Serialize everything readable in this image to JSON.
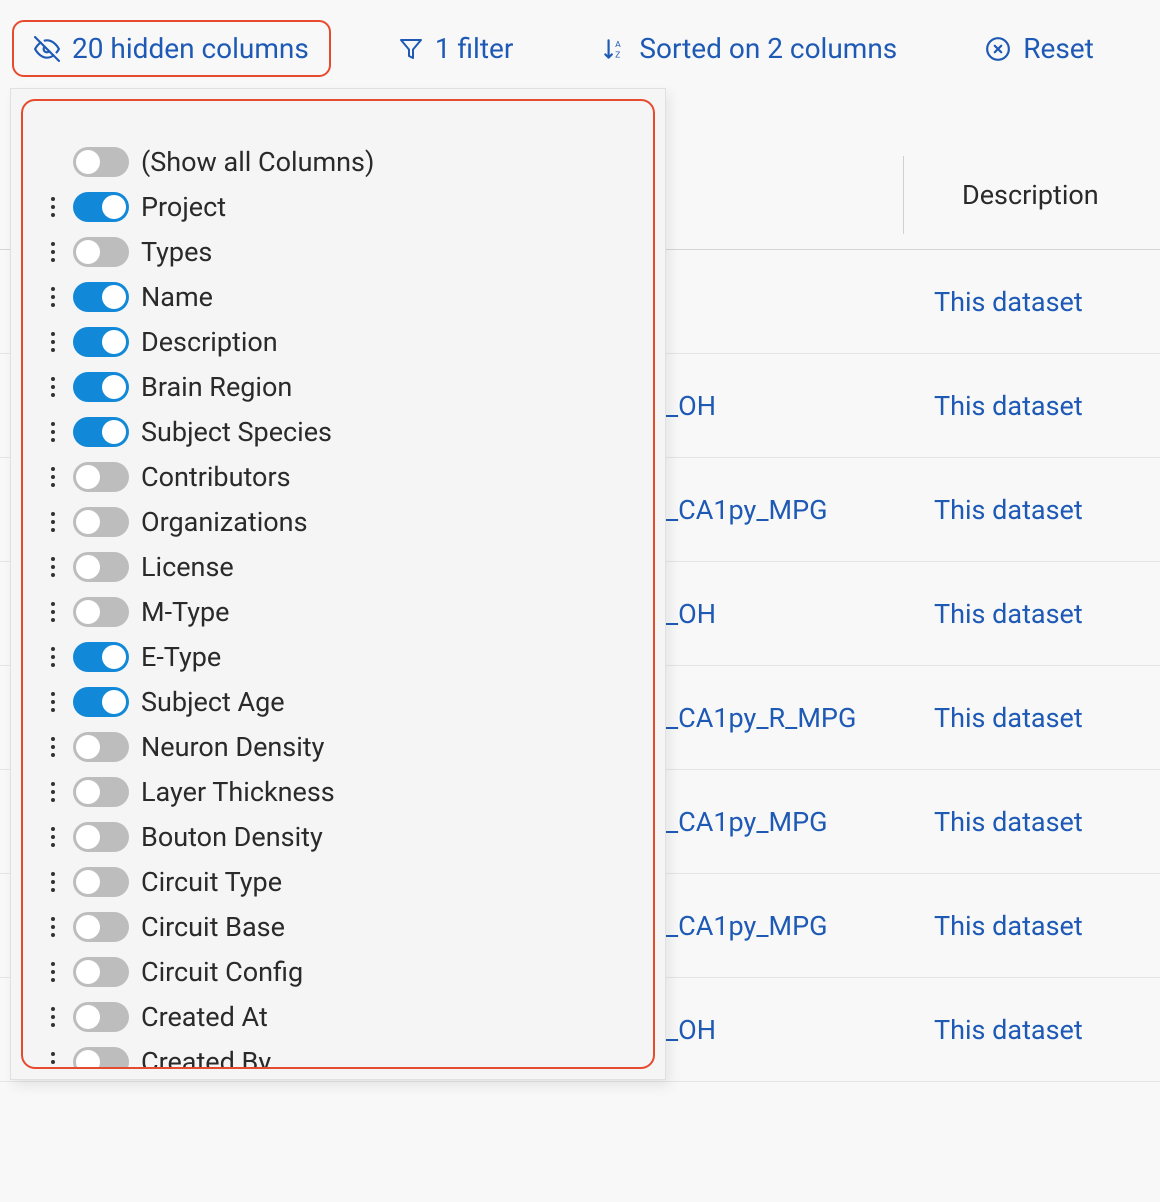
{
  "toolbar": {
    "hidden_columns": "20 hidden columns",
    "filter": "1 filter",
    "sort": "Sorted on 2 columns",
    "reset": "Reset"
  },
  "columns": [
    {
      "label": "(Show all Columns)",
      "enabled": false,
      "handle": false
    },
    {
      "label": "Project",
      "enabled": true,
      "handle": true
    },
    {
      "label": "Types",
      "enabled": false,
      "handle": true
    },
    {
      "label": "Name",
      "enabled": true,
      "handle": true
    },
    {
      "label": "Description",
      "enabled": true,
      "handle": true
    },
    {
      "label": "Brain Region",
      "enabled": true,
      "handle": true
    },
    {
      "label": "Subject Species",
      "enabled": true,
      "handle": true
    },
    {
      "label": "Contributors",
      "enabled": false,
      "handle": true
    },
    {
      "label": "Organizations",
      "enabled": false,
      "handle": true
    },
    {
      "label": "License",
      "enabled": false,
      "handle": true
    },
    {
      "label": "M-Type",
      "enabled": false,
      "handle": true
    },
    {
      "label": "E-Type",
      "enabled": true,
      "handle": true
    },
    {
      "label": "Subject Age",
      "enabled": true,
      "handle": true
    },
    {
      "label": "Neuron Density",
      "enabled": false,
      "handle": true
    },
    {
      "label": "Layer Thickness",
      "enabled": false,
      "handle": true
    },
    {
      "label": "Bouton Density",
      "enabled": false,
      "handle": true
    },
    {
      "label": "Circuit Type",
      "enabled": false,
      "handle": true
    },
    {
      "label": "Circuit Base",
      "enabled": false,
      "handle": true
    },
    {
      "label": "Circuit Config",
      "enabled": false,
      "handle": true
    },
    {
      "label": "Created At",
      "enabled": false,
      "handle": true
    },
    {
      "label": "Created By",
      "enabled": false,
      "handle": true
    }
  ],
  "table": {
    "header_description": "Description",
    "rows": [
      {
        "name": "",
        "desc": "This dataset"
      },
      {
        "name": "_OH",
        "desc": "This dataset"
      },
      {
        "name": "_CA1py_MPG",
        "desc": "This dataset"
      },
      {
        "name": "_OH",
        "desc": "This dataset"
      },
      {
        "name": "_CA1py_R_MPG",
        "desc": "This dataset"
      },
      {
        "name": "_CA1py_MPG",
        "desc": "This dataset"
      },
      {
        "name": "_CA1py_MPG",
        "desc": "This dataset"
      },
      {
        "name": "_OH",
        "desc": "This dataset"
      }
    ]
  }
}
